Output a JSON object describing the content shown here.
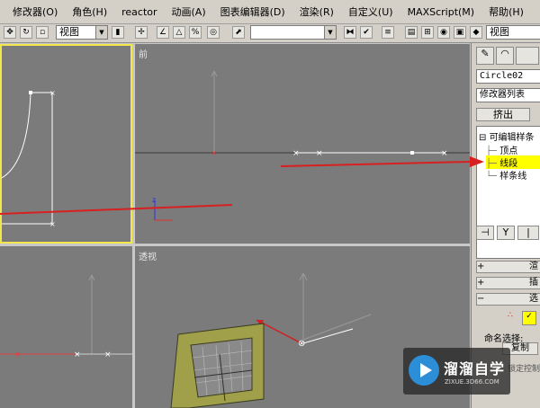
{
  "menu": [
    "修改器(O)",
    "角色(H)",
    "reactor",
    "动画(A)",
    "图表编辑器(D)",
    "渲染(R)",
    "自定义(U)",
    "MAXScript(M)",
    "帮助(H)"
  ],
  "toolbar": {
    "view_select_1": "视图",
    "view_select_2": "视图"
  },
  "viewports": {
    "front_label": "前",
    "perspective_label": "透视",
    "axis_z": "z"
  },
  "command_panel": {
    "object_name": "Circle02",
    "modifier_list": "修改器列表",
    "extrude_button": "挤出",
    "stack": {
      "root": "可编辑样条",
      "items": [
        "顶点",
        "线段",
        "样条线"
      ],
      "selected": "线段"
    },
    "rollouts": [
      "渲",
      "插",
      "选"
    ],
    "named_selection": "命名选择:",
    "copy_button": "复制",
    "lock_text": "锁定控制"
  },
  "watermark": {
    "title": "溜溜自学",
    "url": "ZIXUE.3D66.COM"
  },
  "colors": {
    "viewport_bg": "#7b7b7b",
    "active_border": "#f2e64a",
    "annotation_arrow": "#d82020",
    "selection_highlight": "#ffff00"
  }
}
